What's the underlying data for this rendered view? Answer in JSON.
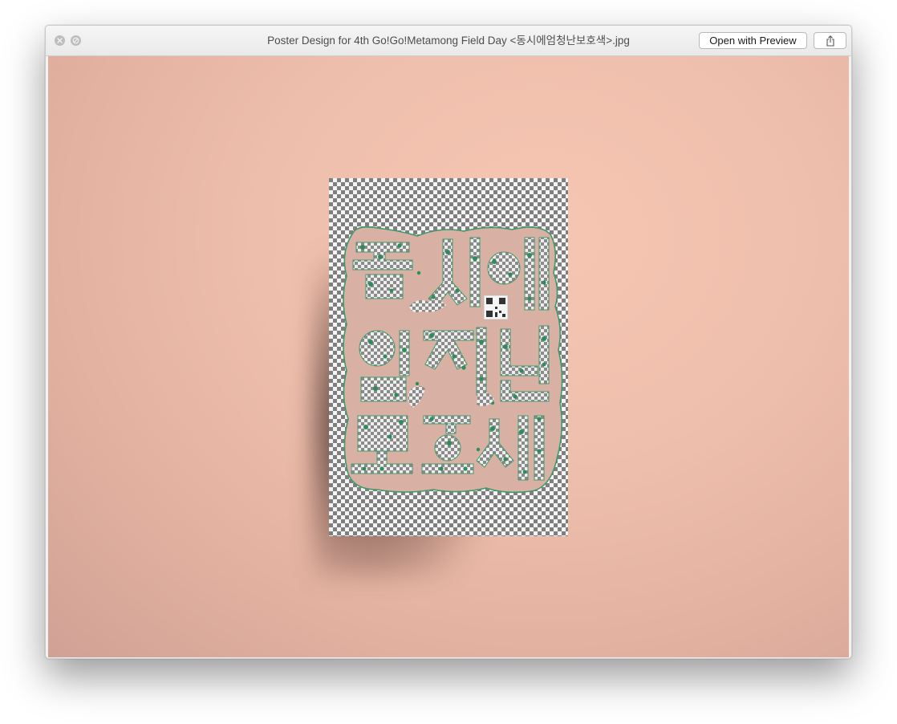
{
  "window": {
    "title": "Poster Design for 4th Go!Go!Metamong Field Day <동시에엄청난보호색>.jpg",
    "open_with_label": "Open with Preview"
  },
  "icons": {
    "close": "close-x-icon",
    "fullscreen": "fullscreen-icon",
    "share": "share-icon"
  },
  "poster": {
    "lettering": "동시에엄청난보호색",
    "colors": {
      "blob_fill": "#d8b0a4",
      "outline": "#3f9a6b",
      "dot_green": "#2f8d5c",
      "checker_dark": "#7f7f7f",
      "checker_light": "#f4f4f4"
    }
  },
  "colors": {
    "backdrop": "#efbfad",
    "titlebar": "#ececec"
  }
}
